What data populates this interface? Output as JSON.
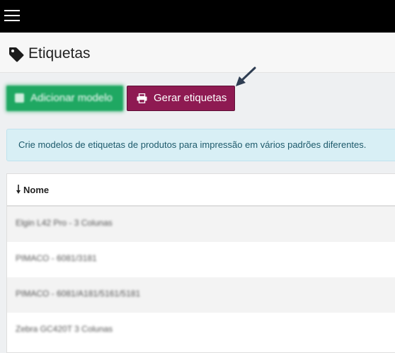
{
  "page": {
    "title": "Etiquetas"
  },
  "toolbar": {
    "add_label": "Adicionar modelo",
    "generate_label": "Gerar etiquetas"
  },
  "info": {
    "message": "Crie modelos de etiquetas de produtos para impressão em vários padrões diferentes."
  },
  "table": {
    "header": "Nome",
    "rows": [
      {
        "name": "Elgin L42 Pro - 3 Colunas"
      },
      {
        "name": "PIMACO - 6081/3181"
      },
      {
        "name": "PIMACO - 6081/A181/5161/5181"
      },
      {
        "name": "Zebra GC420T 3 Colunas"
      }
    ]
  },
  "colors": {
    "topbar": "#000000",
    "add_button": "#1fa862",
    "generate_button": "#8e1a52",
    "info_background": "#d8eff5",
    "info_text": "#1d5a6b"
  },
  "icons": {
    "menu": "hamburger-icon",
    "title": "tag-icon",
    "add": "plus-icon",
    "generate": "printer-icon",
    "sort": "sort-arrow-icon",
    "annotation": "arrow-annotation-icon"
  }
}
